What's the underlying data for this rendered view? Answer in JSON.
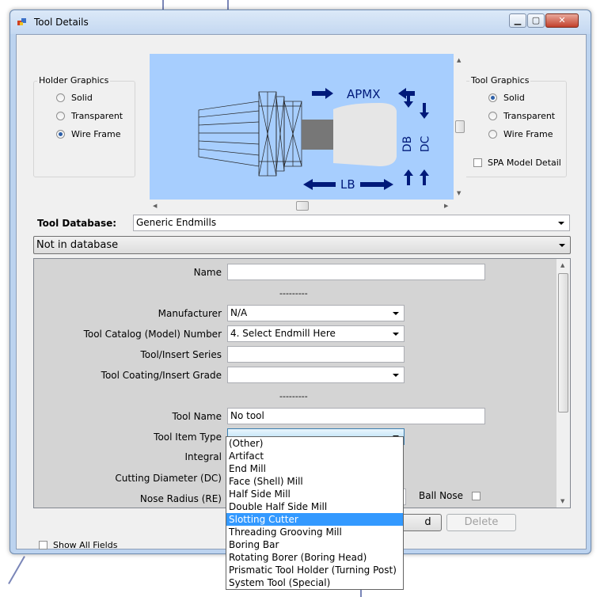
{
  "window": {
    "title": "Tool Details"
  },
  "holder_graphics": {
    "title": "Holder Graphics",
    "options": [
      "Solid",
      "Transparent",
      "Wire Frame"
    ],
    "selected": "Wire Frame"
  },
  "tool_graphics": {
    "title": "Tool Graphics",
    "options": [
      "Solid",
      "Transparent",
      "Wire Frame"
    ],
    "selected": "Solid",
    "spa_label": "SPA Model Detail"
  },
  "diagram_labels": {
    "apmx": "APMX",
    "db": "DB",
    "dc": "DC",
    "lb": "LB"
  },
  "tool_database": {
    "label": "Tool Database:",
    "value": "Generic Endmills"
  },
  "db_status": {
    "value": "Not in database"
  },
  "form": {
    "name_label": "Name",
    "separator": "---------",
    "manufacturer_label": "Manufacturer",
    "manufacturer_value": "N/A",
    "catalog_label": "Tool Catalog (Model) Number",
    "catalog_value": "4. Select Endmill Here",
    "series_label": "Tool/Insert Series",
    "coating_label": "Tool Coating/Insert Grade",
    "tool_name_label": "Tool Name",
    "tool_name_value": "No tool",
    "item_type_label": "Tool Item Type",
    "integral_label": "Integral",
    "cutting_diameter_label": "Cutting Diameter (DC)",
    "nose_radius_label": "Nose Radius (RE)",
    "ball_nose_label": "Ball Nose"
  },
  "item_type_options": [
    "(Other)",
    "Artifact",
    "End Mill",
    "Face (Shell) Mill",
    "Half Side Mill",
    "Double Half Side Mill",
    "Slotting Cutter",
    "Threading Grooving Mill",
    "Boring Bar",
    "Rotating Borer (Boring Head)",
    "Prismatic Tool Holder (Turning Post)",
    "System Tool (Special)"
  ],
  "item_type_highlighted": "Slotting Cutter",
  "buttons": {
    "add_label": "d",
    "delete_label": "Delete"
  },
  "show_all_fields": "Show All Fields",
  "colors": {
    "graphic_bg": "#a7cefe",
    "highlight": "#3399ff",
    "diagram_ink": "#001a7a"
  }
}
